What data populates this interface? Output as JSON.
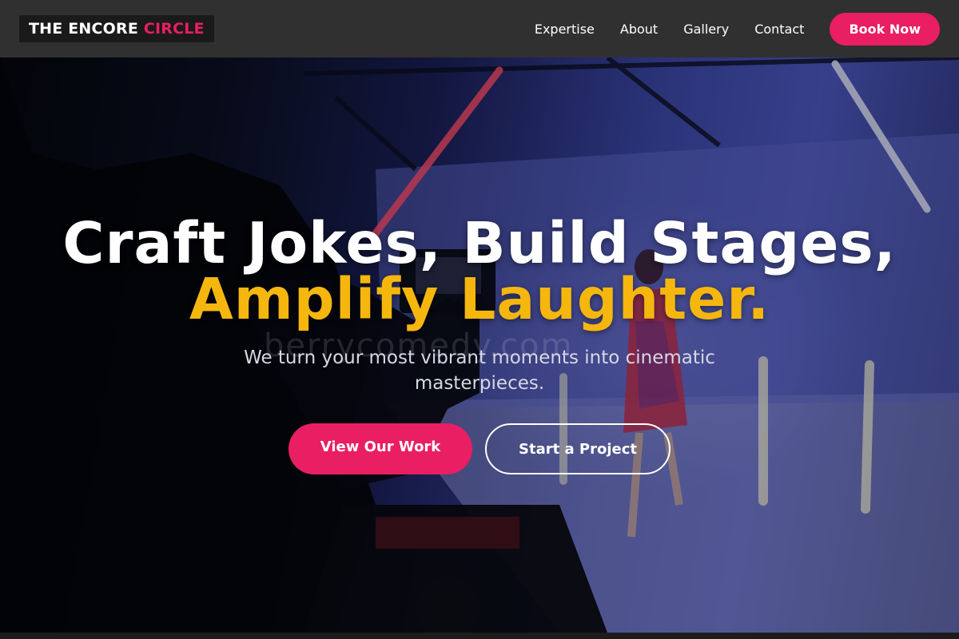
{
  "nav": {
    "logo_main": "THE ENCORE ",
    "logo_accent": "CIRCLE",
    "links": [
      "Expertise",
      "About",
      "Gallery",
      "Contact"
    ],
    "cta_label": "Book Now"
  },
  "hero": {
    "headline_line1": "Craft Jokes, Build Stages,",
    "headline_line2": "Amplify Laughter.",
    "subtitle": "We turn your most vibrant moments into cinematic masterpieces.",
    "primary_cta": "View Our Work",
    "secondary_cta": "Start a Project",
    "watermark": "berrycomedy.com",
    "background_image": "camera-operator-filming-dancer-in-neon-studio"
  },
  "colors": {
    "accent": "#e91e63",
    "highlight": "#f5b70e",
    "navbar": "#313030"
  }
}
